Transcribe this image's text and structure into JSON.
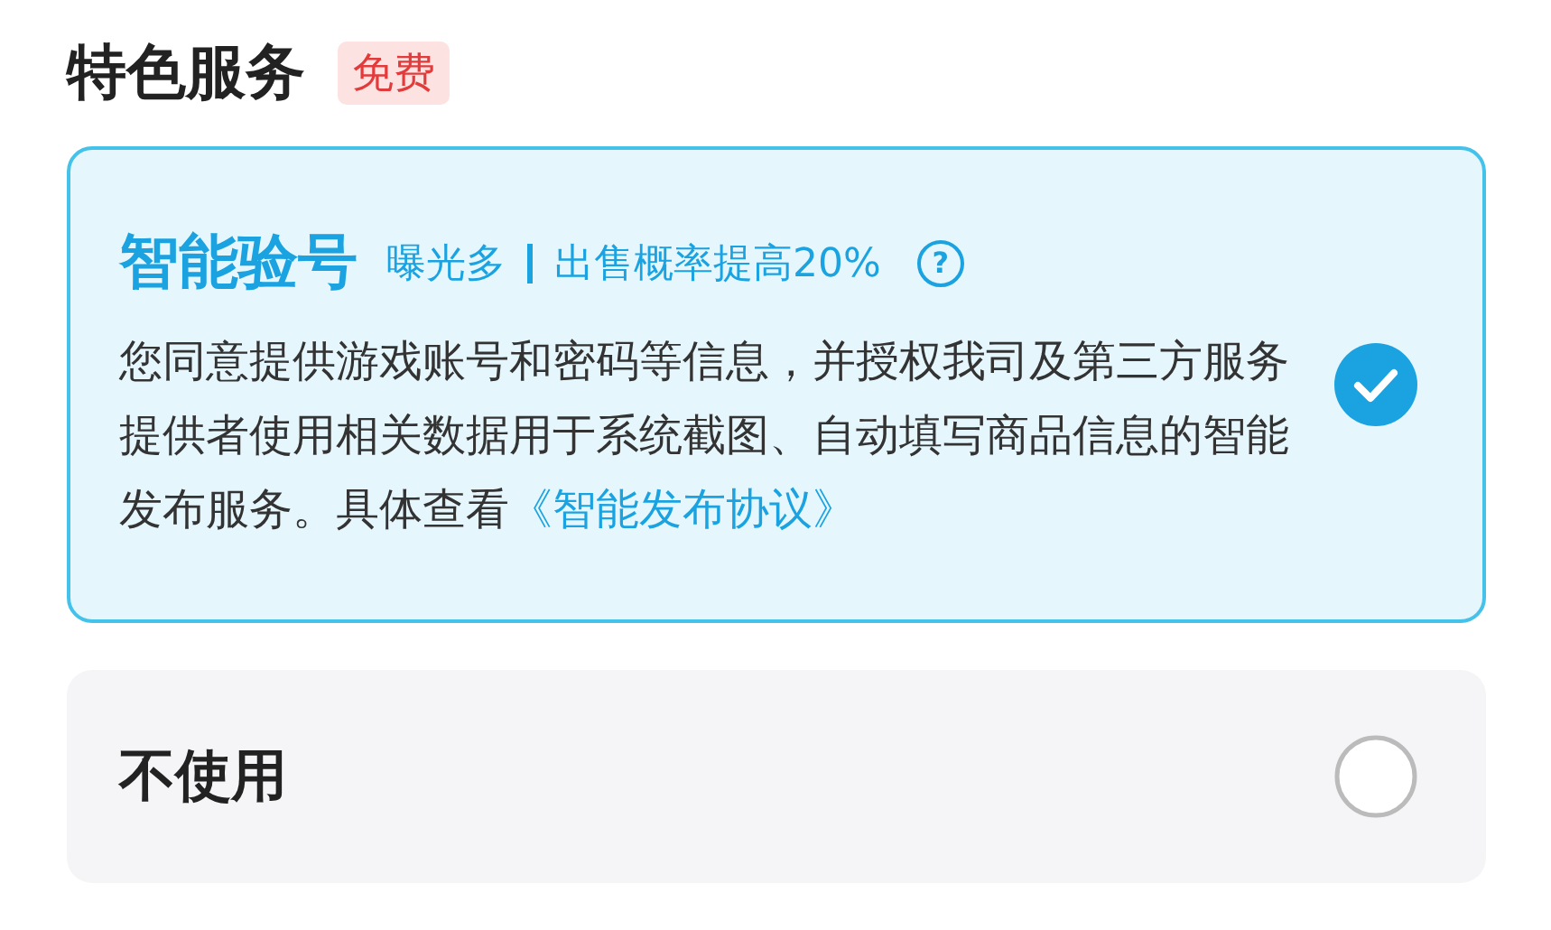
{
  "section": {
    "title": "特色服务",
    "badge": "免费"
  },
  "options": [
    {
      "kind": "featured",
      "title": "智能验号",
      "tags": [
        "曝光多",
        "出售概率提高20%"
      ],
      "help": "?",
      "description": "您同意提供游戏账号和密码等信息，并授权我司及第三方服务提供者使用相关数据用于系统截图、自动填写商品信息的智能发布服务。具体查看",
      "link": "《智能发布协议》",
      "selected": true
    },
    {
      "kind": "plain",
      "title": "不使用",
      "selected": false
    }
  ]
}
